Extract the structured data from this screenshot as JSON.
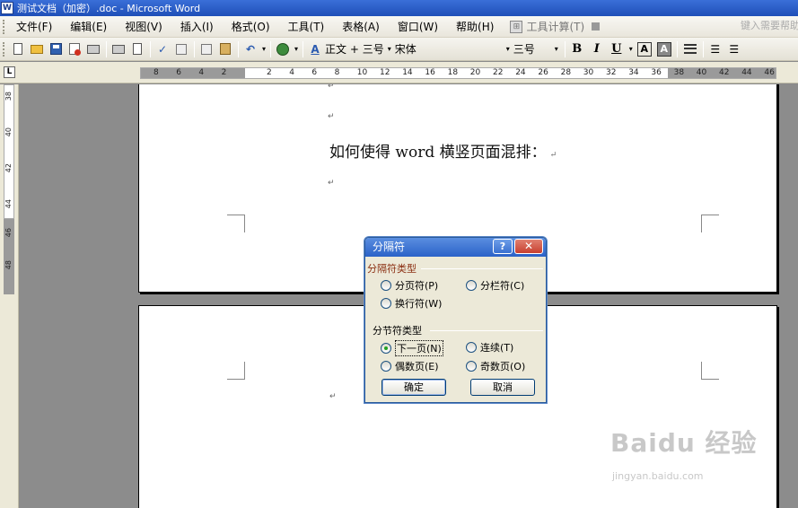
{
  "window": {
    "title": "测试文档（加密）.doc - Microsoft Word",
    "app_icon": "W"
  },
  "menu": {
    "items": [
      "文件(F)",
      "编辑(E)",
      "视图(V)",
      "插入(I)",
      "格式(O)",
      "工具(T)",
      "表格(A)",
      "窗口(W)",
      "帮助(H)"
    ],
    "tool_calc": "工具计算(T)",
    "help_placeholder": "键入需要帮助的问题"
  },
  "toolbar": {
    "style": "正文 + 三号",
    "font": "宋体",
    "size": "三号",
    "bold": "B",
    "italic": "I",
    "underline": "U",
    "border_char": "A",
    "shading_char": "A",
    "aa_icon": "A"
  },
  "ruler": {
    "corner": "L",
    "h_numbers": [
      "8",
      "6",
      "4",
      "2",
      "",
      "2",
      "4",
      "6",
      "8",
      "10",
      "12",
      "14",
      "16",
      "18",
      "20",
      "22",
      "24",
      "26",
      "28",
      "30",
      "32",
      "34",
      "36",
      "38",
      "40",
      "42",
      "44",
      "46"
    ],
    "v_numbers": [
      "38",
      "40",
      "42",
      "44",
      "46",
      "48"
    ]
  },
  "document": {
    "heading": "如何使得 word 横竖页面混排：",
    "paragraph_mark": "↵"
  },
  "dialog": {
    "title": "分隔符",
    "help_btn": "?",
    "close_btn": "✕",
    "group_break": "分隔符类型",
    "opt_page_break": "分页符(P)",
    "opt_column_break": "分栏符(C)",
    "opt_text_wrap": "换行符(W)",
    "group_section": "分节符类型",
    "opt_next_page": "下一页(N)",
    "opt_continuous": "连续(T)",
    "opt_even_page": "偶数页(E)",
    "opt_odd_page": "奇数页(O)",
    "selected": "下一页(N)",
    "ok": "确定",
    "cancel": "取消"
  },
  "watermark": {
    "brand": "Baidu 经验",
    "url": "jingyan.baidu.com"
  }
}
